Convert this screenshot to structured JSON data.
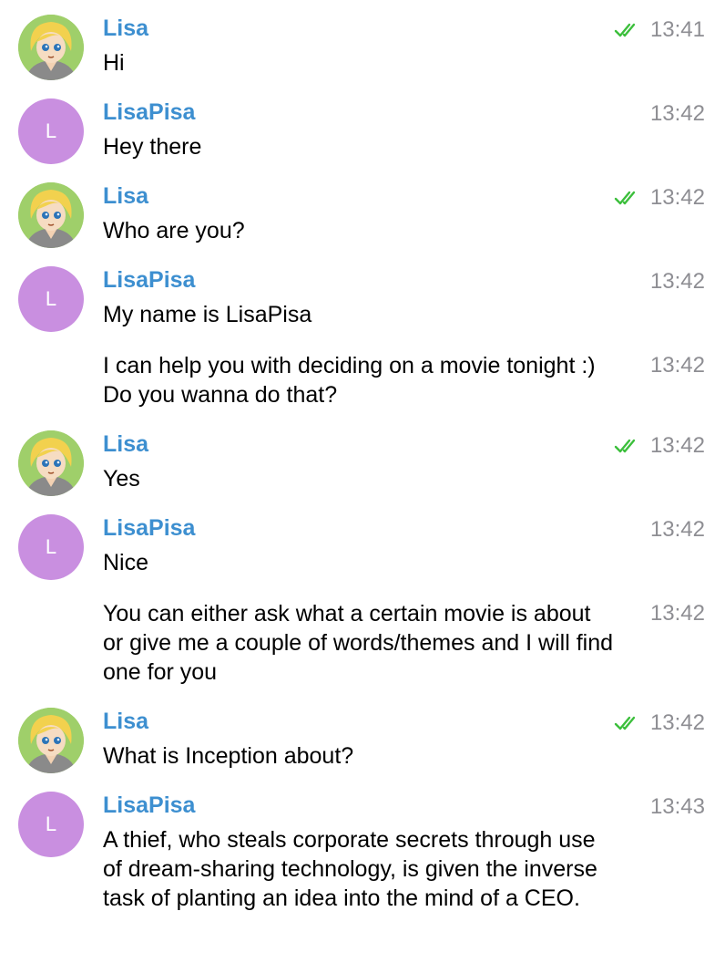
{
  "messages": [
    {
      "sender": "Lisa",
      "text": "Hi",
      "time": "13:41",
      "read": true
    },
    {
      "sender": "LisaPisa",
      "avatar_letter": "L",
      "text": "Hey there",
      "time": "13:42"
    },
    {
      "sender": "Lisa",
      "text": "Who are you?",
      "time": "13:42",
      "read": true
    },
    {
      "sender": "LisaPisa",
      "avatar_letter": "L",
      "text": "My name is LisaPisa",
      "time": "13:42"
    },
    {
      "text": "I can help you with deciding on a movie tonight :) Do you wanna do that?",
      "time": "13:42"
    },
    {
      "sender": "Lisa",
      "text": "Yes",
      "time": "13:42",
      "read": true
    },
    {
      "sender": "LisaPisa",
      "avatar_letter": "L",
      "text": "Nice",
      "time": "13:42"
    },
    {
      "text": "You can either ask what a certain movie is about or give me a couple of words/themes and I will find one for you",
      "time": "13:42"
    },
    {
      "sender": "Lisa",
      "text": "What is Inception about?",
      "time": "13:42",
      "read": true
    },
    {
      "sender": "LisaPisa",
      "avatar_letter": "L",
      "text": "A thief, who steals corporate secrets through use of dream-sharing technology, is given the inverse task of planting an idea into the mind of a CEO.",
      "time": "13:43"
    }
  ],
  "colors": {
    "sender_name": "#3d8fd0",
    "bot_avatar": "#c98fe0",
    "read_check": "#3cbf3c",
    "time": "#8e8e93"
  },
  "icons": {
    "user_avatar": "cartoon-girl-avatar",
    "read_receipt": "double-check-icon"
  }
}
